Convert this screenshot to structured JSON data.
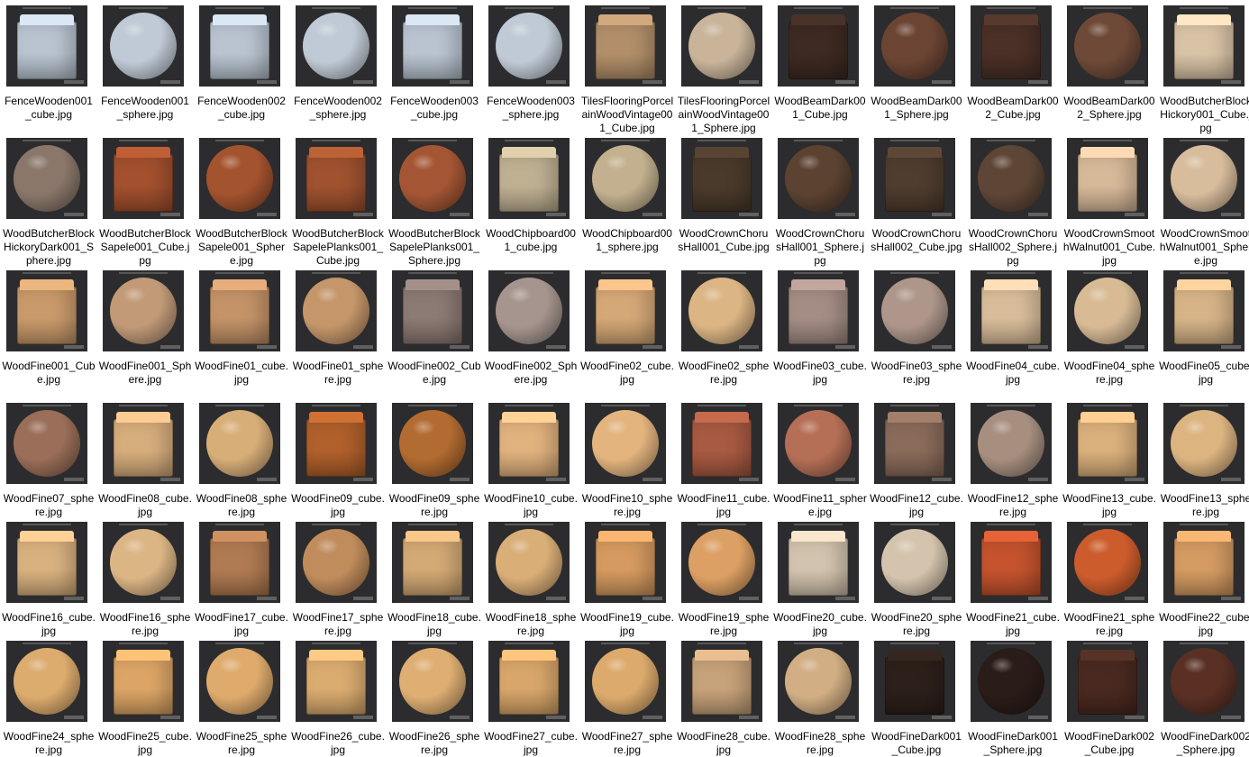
{
  "colors": {
    "thumbnail_bg": "#2c2c2e",
    "page_bg": "#ffffff",
    "label_text": "#000000"
  },
  "files": [
    {
      "name": "FenceWooden001_cube.jpg",
      "shape": "cube",
      "color": "#b9c4d0"
    },
    {
      "name": "FenceWooden001_sphere.jpg",
      "shape": "sphere",
      "color": "#c0cad6"
    },
    {
      "name": "FenceWooden002_cube.jpg",
      "shape": "cube",
      "color": "#b9c4d0"
    },
    {
      "name": "FenceWooden002_sphere.jpg",
      "shape": "sphere",
      "color": "#c0cad6"
    },
    {
      "name": "FenceWooden003_cube.jpg",
      "shape": "cube",
      "color": "#b9c4d0"
    },
    {
      "name": "FenceWooden003_sphere.jpg",
      "shape": "sphere",
      "color": "#c0cad6"
    },
    {
      "name": "TilesFlooringPorcelainWoodVintage001_Cube.jpg",
      "shape": "cube",
      "color": "#b28f6a"
    },
    {
      "name": "TilesFlooringPorcelainWoodVintage001_Sphere.jpg",
      "shape": "sphere",
      "color": "#c9b49a"
    },
    {
      "name": "WoodBeamDark001_Cube.jpg",
      "shape": "cube",
      "color": "#3e2a22"
    },
    {
      "name": "WoodBeamDark001_Sphere.jpg",
      "shape": "sphere",
      "color": "#6b4433"
    },
    {
      "name": "WoodBeamDark002_Cube.jpg",
      "shape": "cube",
      "color": "#4a3027"
    },
    {
      "name": "WoodBeamDark002_Sphere.jpg",
      "shape": "sphere",
      "color": "#6e4938"
    },
    {
      "name": "WoodButcherBlockHickory001_Cube.jpg",
      "shape": "cube",
      "color": "#d9c3a6"
    },
    {
      "name": "WoodButcherBlockHickoryDark001_Sphere.jpg",
      "shape": "sphere",
      "color": "#8a776a"
    },
    {
      "name": "WoodButcherBlockSapele001_Cube.jpg",
      "shape": "cube",
      "color": "#a3502e"
    },
    {
      "name": "WoodButcherBlockSapele001_Sphere.jpg",
      "shape": "sphere",
      "color": "#a4532f"
    },
    {
      "name": "WoodButcherBlockSapelePlanks001_Cube.jpg",
      "shape": "cube",
      "color": "#a0522f"
    },
    {
      "name": "WoodButcherBlockSapelePlanks001_Sphere.jpg",
      "shape": "sphere",
      "color": "#a45634"
    },
    {
      "name": "WoodChipboard001_cube.jpg",
      "shape": "cube",
      "color": "#bfb092"
    },
    {
      "name": "WoodChipboard001_sphere.jpg",
      "shape": "sphere",
      "color": "#c2b08e"
    },
    {
      "name": "WoodCrownChorusHall001_Cube.jpg",
      "shape": "cube",
      "color": "#4b3a2b"
    },
    {
      "name": "WoodCrownChorusHall001_Sphere.jpg",
      "shape": "sphere",
      "color": "#5b4231"
    },
    {
      "name": "WoodCrownChorusHall002_Cube.jpg",
      "shape": "cube",
      "color": "#4f3d2f"
    },
    {
      "name": "WoodCrownChorusHall002_Sphere.jpg",
      "shape": "sphere",
      "color": "#5e4636"
    },
    {
      "name": "WoodCrownSmoothWalnut001_Cube.jpg",
      "shape": "cube",
      "color": "#d6b999"
    },
    {
      "name": "WoodCrownSmoothWalnut001_Sphere.jpg",
      "shape": "sphere",
      "color": "#d8bd9d"
    },
    {
      "name": "WoodFine001_Cube.jpg",
      "shape": "cube",
      "color": "#c99a6b"
    },
    {
      "name": "WoodFine001_Sphere.jpg",
      "shape": "sphere",
      "color": "#c29a78"
    },
    {
      "name": "WoodFine01_cube.jpg",
      "shape": "cube",
      "color": "#c49368"
    },
    {
      "name": "WoodFine01_sphere.jpg",
      "shape": "sphere",
      "color": "#c4966a"
    },
    {
      "name": "WoodFine002_Cube.jpg",
      "shape": "cube",
      "color": "#8c7a74"
    },
    {
      "name": "WoodFine002_Sphere.jpg",
      "shape": "sphere",
      "color": "#a6958e"
    },
    {
      "name": "WoodFine02_cube.jpg",
      "shape": "cube",
      "color": "#d5a877"
    },
    {
      "name": "WoodFine02_sphere.jpg",
      "shape": "sphere",
      "color": "#dcb584"
    },
    {
      "name": "WoodFine03_cube.jpg",
      "shape": "cube",
      "color": "#a48d85"
    },
    {
      "name": "WoodFine03_sphere.jpg",
      "shape": "sphere",
      "color": "#ae968a"
    },
    {
      "name": "WoodFine04_cube.jpg",
      "shape": "cube",
      "color": "#d9bd9b"
    },
    {
      "name": "WoodFine04_sphere.jpg",
      "shape": "sphere",
      "color": "#d8bb95"
    },
    {
      "name": "WoodFine05_cube.jpg",
      "shape": "cube",
      "color": "#d6b488"
    },
    {
      "name": "WoodFine07_sphere.jpg",
      "shape": "sphere",
      "color": "#9a6e58"
    },
    {
      "name": "WoodFine08_cube.jpg",
      "shape": "cube",
      "color": "#d6ad7c"
    },
    {
      "name": "WoodFine08_sphere.jpg",
      "shape": "sphere",
      "color": "#d8ae78"
    },
    {
      "name": "WoodFine09_cube.jpg",
      "shape": "cube",
      "color": "#b0602b"
    },
    {
      "name": "WoodFine09_sphere.jpg",
      "shape": "sphere",
      "color": "#b26b30"
    },
    {
      "name": "WoodFine10_cube.jpg",
      "shape": "cube",
      "color": "#e0b27e"
    },
    {
      "name": "WoodFine10_sphere.jpg",
      "shape": "sphere",
      "color": "#e3b47e"
    },
    {
      "name": "WoodFine11_cube.jpg",
      "shape": "cube",
      "color": "#a85a42"
    },
    {
      "name": "WoodFine11_sphere.jpg",
      "shape": "sphere",
      "color": "#b56f56"
    },
    {
      "name": "WoodFine12_cube.jpg",
      "shape": "cube",
      "color": "#8a6b5a"
    },
    {
      "name": "WoodFine12_sphere.jpg",
      "shape": "sphere",
      "color": "#a78f7f"
    },
    {
      "name": "WoodFine13_cube.jpg",
      "shape": "cube",
      "color": "#dab07c"
    },
    {
      "name": "WoodFine13_sphere.jpg",
      "shape": "sphere",
      "color": "#dcb480"
    },
    {
      "name": "WoodFine16_cube.jpg",
      "shape": "cube",
      "color": "#d8b17f"
    },
    {
      "name": "WoodFine16_sphere.jpg",
      "shape": "sphere",
      "color": "#dcb585"
    },
    {
      "name": "WoodFine17_cube.jpg",
      "shape": "cube",
      "color": "#b07b52"
    },
    {
      "name": "WoodFine17_sphere.jpg",
      "shape": "sphere",
      "color": "#c08c5c"
    },
    {
      "name": "WoodFine18_cube.jpg",
      "shape": "cube",
      "color": "#d3a975"
    },
    {
      "name": "WoodFine18_sphere.jpg",
      "shape": "sphere",
      "color": "#d9ae77"
    },
    {
      "name": "WoodFine19_cube.jpg",
      "shape": "cube",
      "color": "#d49a5f"
    },
    {
      "name": "WoodFine19_sphere.jpg",
      "shape": "sphere",
      "color": "#dca064"
    },
    {
      "name": "WoodFine20_cube.jpg",
      "shape": "cube",
      "color": "#d2c3ae"
    },
    {
      "name": "WoodFine20_sphere.jpg",
      "shape": "sphere",
      "color": "#d5c4ad"
    },
    {
      "name": "WoodFine21_cube.jpg",
      "shape": "cube",
      "color": "#c4532e"
    },
    {
      "name": "WoodFine21_sphere.jpg",
      "shape": "sphere",
      "color": "#cc5c2c"
    },
    {
      "name": "WoodFine22_cube.jpg",
      "shape": "cube",
      "color": "#d49b62"
    },
    {
      "name": "WoodFine24_sphere.jpg",
      "shape": "sphere",
      "color": "#dcab6e"
    },
    {
      "name": "WoodFine25_cube.jpg",
      "shape": "cube",
      "color": "#dca566"
    },
    {
      "name": "WoodFine25_sphere.jpg",
      "shape": "sphere",
      "color": "#dfab6c"
    },
    {
      "name": "WoodFine26_cube.jpg",
      "shape": "cube",
      "color": "#dbac70"
    },
    {
      "name": "WoodFine26_sphere.jpg",
      "shape": "sphere",
      "color": "#deae72"
    },
    {
      "name": "WoodFine27_cube.jpg",
      "shape": "cube",
      "color": "#d8a66a"
    },
    {
      "name": "WoodFine27_sphere.jpg",
      "shape": "sphere",
      "color": "#dcaa6c"
    },
    {
      "name": "WoodFine28_cube.jpg",
      "shape": "cube",
      "color": "#c6a27a"
    },
    {
      "name": "WoodFine28_sphere.jpg",
      "shape": "sphere",
      "color": "#d1ae83"
    },
    {
      "name": "WoodFineDark001_Cube.jpg",
      "shape": "cube",
      "color": "#2d201b"
    },
    {
      "name": "WoodFineDark001_Sphere.jpg",
      "shape": "sphere",
      "color": "#2a1c18"
    },
    {
      "name": "WoodFineDark002_Cube.jpg",
      "shape": "cube",
      "color": "#4a2a20"
    },
    {
      "name": "WoodFineDark002_Sphere.jpg",
      "shape": "sphere",
      "color": "#5a3024"
    }
  ]
}
